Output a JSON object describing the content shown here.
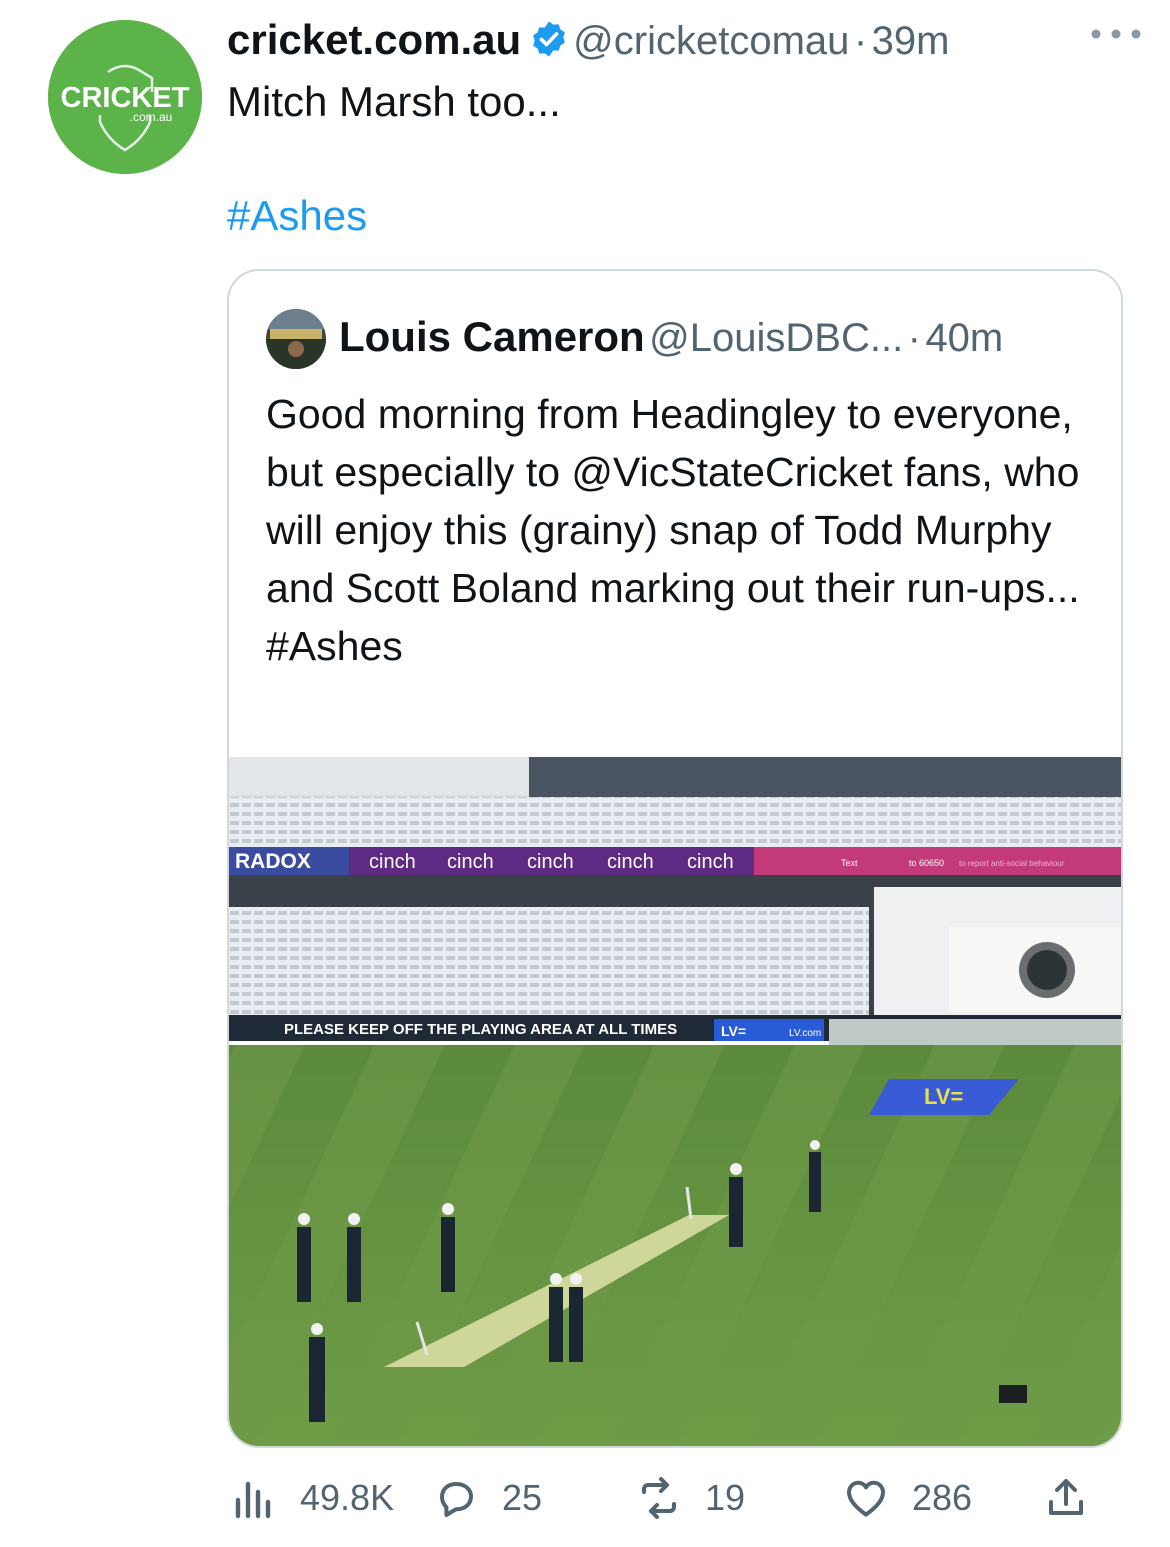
{
  "tweet": {
    "author_name": "cricket.com.au",
    "author_handle": "@cricketcomau",
    "separator": "·",
    "time": "39m",
    "text": "Mitch Marsh too...",
    "hashtag": "#Ashes",
    "avatar_logo_text": "CRICKET",
    "avatar_logo_sub": ".com.au",
    "colors": {
      "avatar_bg": "#5bb349",
      "link": "#1d9bf0",
      "verified": "#1d9bf0",
      "secondary_text": "#536471"
    }
  },
  "quoted_tweet": {
    "author_name": "Louis Cameron",
    "author_handle": "@LouisDBC...",
    "separator": "·",
    "time": "40m",
    "text": "Good morning from Headingley to everyone, but especially to @VicStateCricket fans, who will enjoy this (grainy) snap of Todd Murphy and Scott Boland marking out their run-ups...",
    "hashtag": "#Ashes"
  },
  "photo": {
    "board_radox": "RADOX",
    "board_cinch": "cinch",
    "board_text_sms": "Text",
    "board_text_number": "to 60650",
    "board_text_tail": "to report anti-social behaviour",
    "board_keep_off": "PLEASE KEEP OFF THE PLAYING AREA AT ALL TIMES",
    "board_lv": "LV=",
    "board_lv_com": "LV.com",
    "field_logo": "LV="
  },
  "actions": {
    "views": "49.8K",
    "replies": "25",
    "retweets": "19",
    "likes": "286"
  }
}
